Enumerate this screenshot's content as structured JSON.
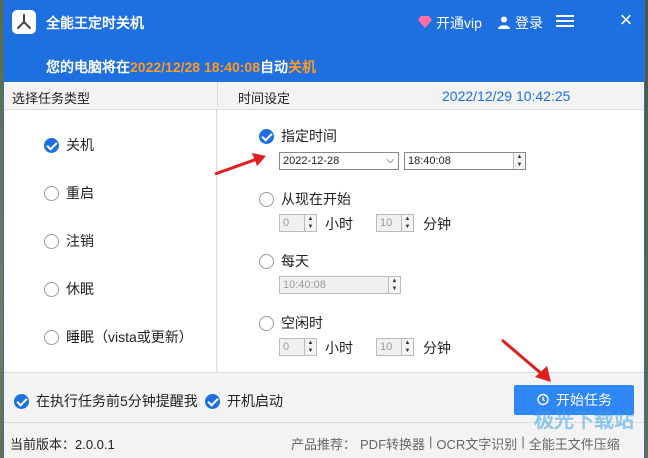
{
  "titlebar": {
    "app_title": "全能王定时关机",
    "vip_label": "开通vip",
    "login_label": "登录",
    "notice_prefix": "您的电脑将在",
    "notice_time": "2022/12/28 18:40:08",
    "notice_mid": "自动",
    "notice_action": "关机"
  },
  "left": {
    "header": "选择任务类型",
    "options": [
      {
        "label": "关机",
        "checked": true
      },
      {
        "label": "重启",
        "checked": false
      },
      {
        "label": "注销",
        "checked": false
      },
      {
        "label": "休眠",
        "checked": false
      },
      {
        "label": "睡眠（vista或更新）",
        "checked": false
      }
    ]
  },
  "right": {
    "header": "时间设定",
    "clock": "2022/12/29 10:42:25",
    "specified": {
      "label": "指定时间",
      "date": "2022-12-28",
      "time": "18:40:08"
    },
    "from_now": {
      "label": "从现在开始",
      "hours": "0",
      "hours_unit": "小时",
      "minutes": "10",
      "minutes_unit": "分钟"
    },
    "daily": {
      "label": "每天",
      "time": "10:40:08"
    },
    "idle": {
      "label": "空闲时",
      "hours": "0",
      "hours_unit": "小时",
      "minutes": "10",
      "minutes_unit": "分钟"
    }
  },
  "footer": {
    "remind_label": "在执行任务前5分钟提醒我",
    "autostart_label": "开机启动",
    "start_label": "开始任务"
  },
  "status": {
    "version": "当前版本：2.0.0.1",
    "promo_prefix": "产品推荐：",
    "promo_pdf": "PDF转换器",
    "sep": "|",
    "promo_ocr": "OCR文字识别",
    "promo_zip": "全能王文件压缩"
  },
  "watermark": "极光下载站",
  "colors": {
    "accent": "#1e6fe0",
    "highlight": "#ff9a1f",
    "button": "#2f86f6",
    "arrow": "#e02020"
  }
}
